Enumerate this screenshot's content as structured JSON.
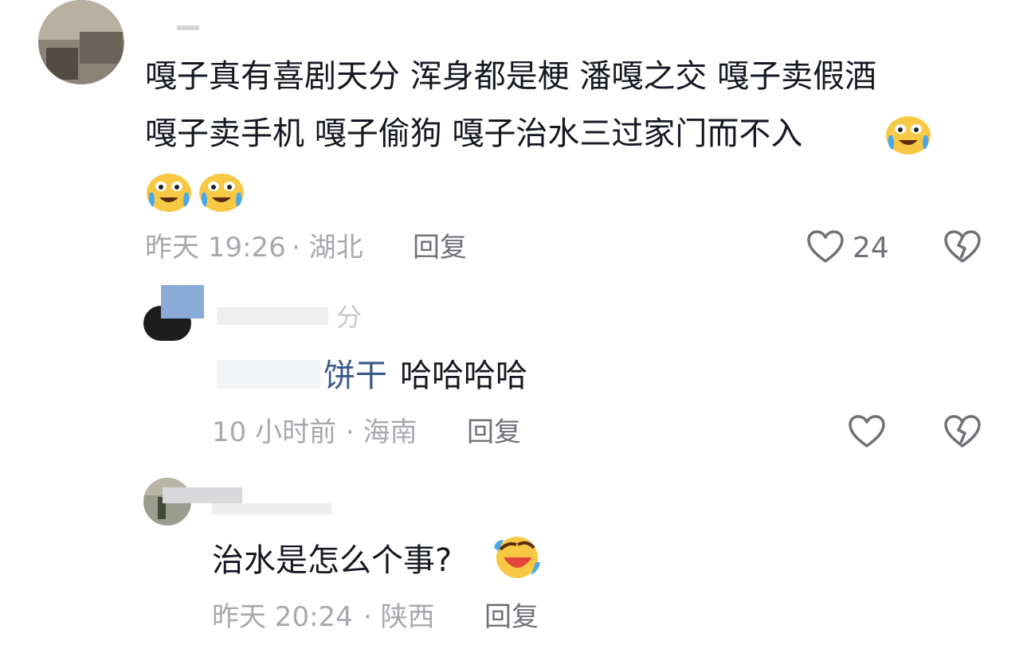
{
  "comments": [
    {
      "text_line1": "嘎子真有喜剧天分 浑身都是梗 潘嘎之交 嘎子卖假酒",
      "text_line2": "嘎子卖手机  嘎子偷狗 嘎子治水三过家门而不入",
      "time": "昨天 19:26",
      "location": "· 湖北",
      "reply_label": "回复",
      "like_count": "24",
      "emoji": "crying-laugh"
    },
    {
      "name_partial": "分",
      "mention": "饼干",
      "text": "哈哈哈哈",
      "time": "10 小时前",
      "location": "· 海南",
      "reply_label": "回复"
    },
    {
      "text": "治水是怎么个事?",
      "time": "昨天 20:24",
      "location": "· 陕西",
      "reply_label": "回复",
      "emoji": "rofl"
    }
  ],
  "colors": {
    "text": "#161823",
    "meta": "#a7a8ad",
    "icon": "#6f7078",
    "mention": "#3a5a8c"
  }
}
